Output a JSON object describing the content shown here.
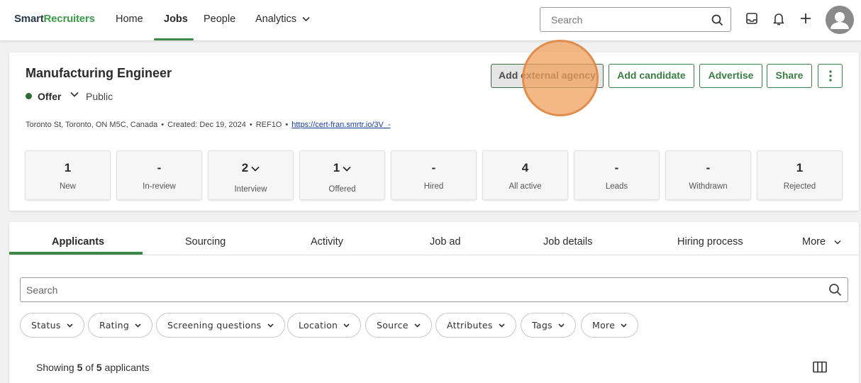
{
  "nav": {
    "logo_part1": "Smart",
    "logo_part2": "Recruiters",
    "links": [
      "Home",
      "Jobs",
      "People",
      "Analytics"
    ],
    "active_link": "Jobs",
    "search_placeholder": "Search",
    "icons": [
      "search-icon",
      "inbox-icon",
      "bell-icon",
      "plus-icon",
      "avatar-icon"
    ]
  },
  "job": {
    "title": "Manufacturing Engineer",
    "status": "Offer",
    "visibility": "Public",
    "location": "Toronto St, Toronto, ON M5C, Canada",
    "created": "Created: Dec 19, 2024",
    "ref": "REF1O",
    "link": "https://cert-fran.smrtr.io/3V_-",
    "separator": "•",
    "status_color": "#2f6b35"
  },
  "actions": {
    "add_external_agency": "Add external agency",
    "add_candidate": "Add candidate",
    "advertise": "Advertise",
    "share": "Share"
  },
  "stats": [
    {
      "value": "1",
      "label": "New",
      "dropdown": false
    },
    {
      "value": "-",
      "label": "In-review",
      "dropdown": false
    },
    {
      "value": "2",
      "label": "Interview",
      "dropdown": true
    },
    {
      "value": "1",
      "label": "Offered",
      "dropdown": true
    },
    {
      "value": "-",
      "label": "Hired",
      "dropdown": false
    },
    {
      "value": "4",
      "label": "All active",
      "dropdown": false
    },
    {
      "value": "-",
      "label": "Leads",
      "dropdown": false
    },
    {
      "value": "-",
      "label": "Withdrawn",
      "dropdown": false
    },
    {
      "value": "1",
      "label": "Rejected",
      "dropdown": false
    }
  ],
  "tabs": [
    "Applicants",
    "Sourcing",
    "Activity",
    "Job ad",
    "Job details",
    "Hiring process",
    "More"
  ],
  "active_tab": "Applicants",
  "applicants": {
    "search_placeholder": "Search",
    "filters": [
      "Status",
      "Rating",
      "Screening questions",
      "Location",
      "Source",
      "Attributes",
      "Tags",
      "More"
    ],
    "showing_prefix": "Showing ",
    "shown_count": "5",
    "of": " of ",
    "total_count": "5",
    "suffix": " applicants"
  },
  "colors": {
    "brand_green": "#3b7d44",
    "accent_green": "#3c8a4a",
    "click_highlight": "#f0a05f"
  }
}
